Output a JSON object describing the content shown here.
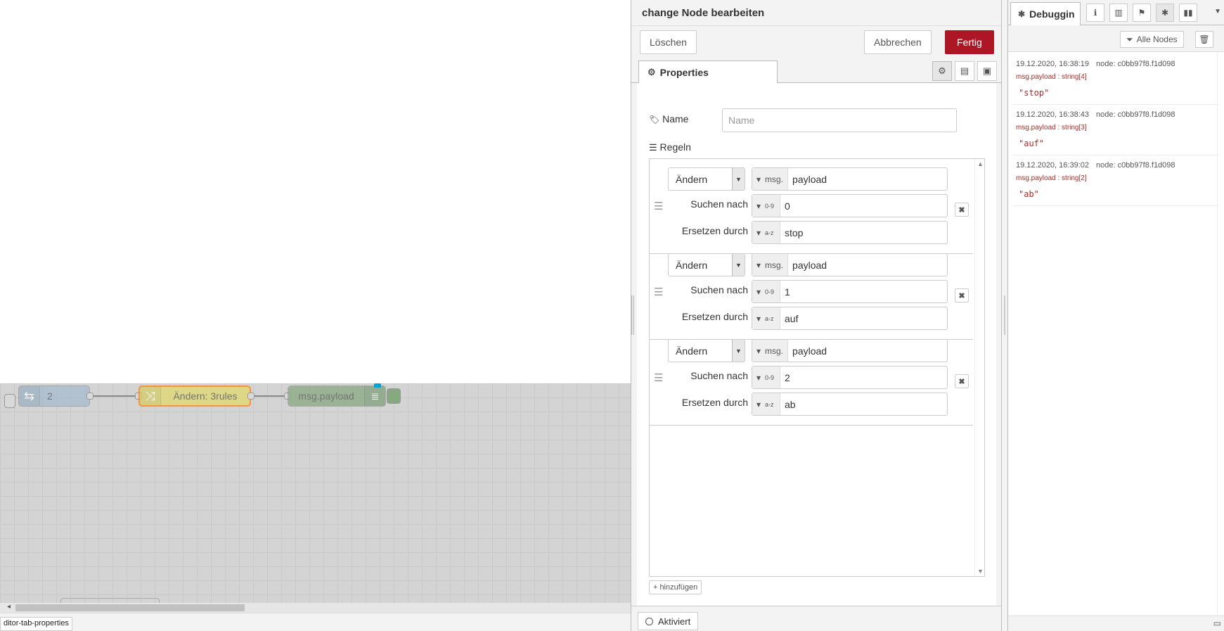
{
  "workspace": {
    "nodes": [
      {
        "id": "inject",
        "label": "2",
        "icon": "inject-arrows-icon",
        "color": "#a6bbcf"
      },
      {
        "id": "change",
        "label": "Ändern: 3rules",
        "icon": "shuffle-icon",
        "color": "#e2d96e"
      },
      {
        "id": "debug",
        "label": "msg.payload",
        "icon": "list-icon",
        "color": "#87a980"
      }
    ],
    "status_tip": "ditor-tab-properties"
  },
  "tray": {
    "title": "change Node bearbeiten",
    "delete_label": "Löschen",
    "cancel_label": "Abbrechen",
    "done_label": "Fertig",
    "tab_label": "Properties",
    "name_label": "Name",
    "name_placeholder": "Name",
    "rules_label": "Regeln",
    "rules": [
      {
        "action": "Ändern",
        "target_type": "msg.",
        "target": "payload",
        "search_label": "Suchen nach",
        "search_type": "0-9",
        "search_value": "0",
        "replace_label": "Ersetzen durch",
        "replace_type": "a-z",
        "replace_value": "stop"
      },
      {
        "action": "Ändern",
        "target_type": "msg.",
        "target": "payload",
        "search_label": "Suchen nach",
        "search_type": "0-9",
        "search_value": "1",
        "replace_label": "Ersetzen durch",
        "replace_type": "a-z",
        "replace_value": "auf"
      },
      {
        "action": "Ändern",
        "target_type": "msg.",
        "target": "payload",
        "search_label": "Suchen nach",
        "search_type": "0-9",
        "search_value": "2",
        "replace_label": "Ersetzen durch",
        "replace_type": "a-z",
        "replace_value": "ab"
      }
    ],
    "add_label": "hinzufügen",
    "enabled_label": "Aktiviert"
  },
  "sidebar": {
    "tab_label": "Debuggin",
    "filter_label": "Alle Nodes",
    "messages": [
      {
        "time": "19.12.2020, 16:38:19",
        "node": "node: c0bb97f8.f1d098",
        "path": "msg.payload : string[4]",
        "value": "\"stop\""
      },
      {
        "time": "19.12.2020, 16:38:43",
        "node": "node: c0bb97f8.f1d098",
        "path": "msg.payload : string[3]",
        "value": "\"auf\""
      },
      {
        "time": "19.12.2020, 16:39:02",
        "node": "node: c0bb97f8.f1d098",
        "path": "msg.payload : string[2]",
        "value": "\"ab\""
      }
    ]
  },
  "colors": {
    "primary": "#ad1625",
    "debug_value": "#b72828"
  }
}
